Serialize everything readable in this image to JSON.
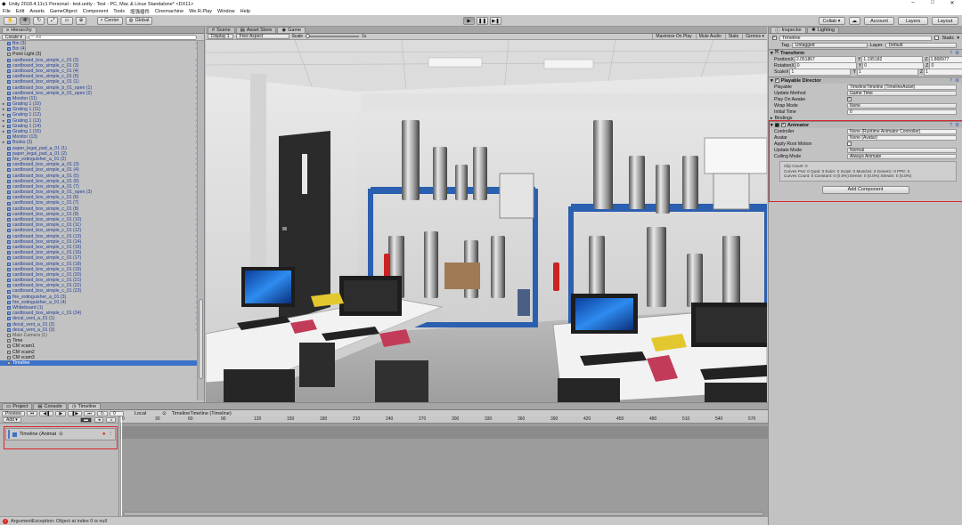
{
  "window": {
    "title": "Unity 2018.4.11c1 Personal - test.unity - Test - PC, Mac & Linux Standalone* <DX11>",
    "controls": [
      "–",
      "□",
      "✕"
    ]
  },
  "menu": [
    "File",
    "Edit",
    "Assets",
    "GameObject",
    "Component",
    "Tools",
    "增强插件",
    "Cinemachine",
    "We.R.Play",
    "Window",
    "Help"
  ],
  "toolbar": {
    "pivot_label": "Center",
    "space_label": "Global",
    "collab_label": "Collab ▾",
    "account_label": "Account",
    "layers_label": "Layers",
    "layout_label": "Layout"
  },
  "hierarchy": {
    "tab_label": "Hierarchy",
    "create_label": "Create ▾",
    "search_placeholder": "All",
    "items": [
      {
        "label": "Bin (3)",
        "type": "blue",
        "arrow": false
      },
      {
        "label": "Bin (4)",
        "type": "blue",
        "arrow": false
      },
      {
        "label": "Point Light (3)",
        "type": "black",
        "arrow": false
      },
      {
        "label": "cardboard_box_simple_c_01 (2)",
        "type": "blue",
        "arrow": false
      },
      {
        "label": "cardboard_box_simple_c_01 (3)",
        "type": "blue",
        "arrow": false
      },
      {
        "label": "cardboard_box_simple_c_01 (4)",
        "type": "blue",
        "arrow": false
      },
      {
        "label": "cardboard_box_simple_c_01 (5)",
        "type": "blue",
        "arrow": false
      },
      {
        "label": "cardboard_box_simple_a_01 (1)",
        "type": "blue",
        "arrow": false
      },
      {
        "label": "cardboard_box_simple_b_01_open (1)",
        "type": "blue",
        "arrow": false
      },
      {
        "label": "cardboard_box_simple_b_01_open (2)",
        "type": "blue",
        "arrow": false
      },
      {
        "label": "Monitor (11)",
        "type": "blue",
        "arrow": false
      },
      {
        "label": "Grating 1 (10)",
        "type": "blue",
        "arrow": true
      },
      {
        "label": "Grating 1 (11)",
        "type": "blue",
        "arrow": true
      },
      {
        "label": "Grating 1 (12)",
        "type": "blue",
        "arrow": true
      },
      {
        "label": "Grating 1 (13)",
        "type": "blue",
        "arrow": true
      },
      {
        "label": "Grating 1 (14)",
        "type": "blue",
        "arrow": true
      },
      {
        "label": "Grating 1 (15)",
        "type": "blue",
        "arrow": true
      },
      {
        "label": "Monitor (13)",
        "type": "blue",
        "arrow": false
      },
      {
        "label": "Books (3)",
        "type": "blue",
        "arrow": true
      },
      {
        "label": "paper_legal_pad_a_01 (1)",
        "type": "blue",
        "arrow": false
      },
      {
        "label": "paper_legal_pad_a_01 (2)",
        "type": "blue",
        "arrow": false
      },
      {
        "label": "fire_extinguisher_a_01 (2)",
        "type": "blue",
        "arrow": false
      },
      {
        "label": "cardboard_box_simple_a_01 (3)",
        "type": "blue",
        "arrow": false
      },
      {
        "label": "cardboard_box_simple_a_01 (4)",
        "type": "blue",
        "arrow": false
      },
      {
        "label": "cardboard_box_simple_a_01 (5)",
        "type": "blue",
        "arrow": false
      },
      {
        "label": "cardboard_box_simple_a_01 (6)",
        "type": "blue",
        "arrow": false
      },
      {
        "label": "cardboard_box_simple_a_01 (7)",
        "type": "blue",
        "arrow": false
      },
      {
        "label": "cardboard_box_simple_b_01_open (3)",
        "type": "blue",
        "arrow": false
      },
      {
        "label": "cardboard_box_simple_c_01 (6)",
        "type": "blue",
        "arrow": false
      },
      {
        "label": "cardboard_box_simple_c_01 (7)",
        "type": "blue",
        "arrow": false
      },
      {
        "label": "cardboard_box_simple_c_01 (8)",
        "type": "blue",
        "arrow": false
      },
      {
        "label": "cardboard_box_simple_c_01 (9)",
        "type": "blue",
        "arrow": false
      },
      {
        "label": "cardboard_box_simple_c_01 (10)",
        "type": "blue",
        "arrow": false
      },
      {
        "label": "cardboard_box_simple_c_01 (11)",
        "type": "blue",
        "arrow": false
      },
      {
        "label": "cardboard_box_simple_c_01 (12)",
        "type": "blue",
        "arrow": false
      },
      {
        "label": "cardboard_box_simple_c_01 (13)",
        "type": "blue",
        "arrow": false
      },
      {
        "label": "cardboard_box_simple_c_01 (14)",
        "type": "blue",
        "arrow": false
      },
      {
        "label": "cardboard_box_simple_c_01 (15)",
        "type": "blue",
        "arrow": false
      },
      {
        "label": "cardboard_box_simple_c_01 (16)",
        "type": "blue",
        "arrow": false
      },
      {
        "label": "cardboard_box_simple_c_01 (17)",
        "type": "blue",
        "arrow": false
      },
      {
        "label": "cardboard_box_simple_c_01 (18)",
        "type": "blue",
        "arrow": false
      },
      {
        "label": "cardboard_box_simple_c_01 (19)",
        "type": "blue",
        "arrow": false
      },
      {
        "label": "cardboard_box_simple_c_01 (20)",
        "type": "blue",
        "arrow": false
      },
      {
        "label": "cardboard_box_simple_c_01 (21)",
        "type": "blue",
        "arrow": false
      },
      {
        "label": "cardboard_box_simple_c_01 (22)",
        "type": "blue",
        "arrow": false
      },
      {
        "label": "cardboard_box_simple_c_01 (23)",
        "type": "blue",
        "arrow": false
      },
      {
        "label": "fire_extinguisher_a_01 (3)",
        "type": "blue",
        "arrow": false
      },
      {
        "label": "fire_extinguisher_a_01 (4)",
        "type": "blue",
        "arrow": false
      },
      {
        "label": "Whiteboard (1)",
        "type": "blue",
        "arrow": false
      },
      {
        "label": "cardboard_box_simple_c_01 (24)",
        "type": "blue",
        "arrow": false
      },
      {
        "label": "decal_vent_a_01 (1)",
        "type": "blue",
        "arrow": false
      },
      {
        "label": "decal_vent_a_01 (2)",
        "type": "blue",
        "arrow": false
      },
      {
        "label": "decal_vent_a_01 (3)",
        "type": "blue",
        "arrow": false
      },
      {
        "label": "Main Camera (1)",
        "type": "gray",
        "arrow": false
      },
      {
        "label": "Time",
        "type": "black",
        "arrow": false
      },
      {
        "label": "CM vcam1",
        "type": "black",
        "arrow": false
      },
      {
        "label": "CM vcam2",
        "type": "black",
        "arrow": false
      },
      {
        "label": "CM vcam3",
        "type": "black",
        "arrow": false
      },
      {
        "label": "Timeline",
        "type": "selected",
        "arrow": false
      }
    ]
  },
  "scene_tabs": [
    "Scene",
    "Asset Store",
    "Game"
  ],
  "game_bar": {
    "display": "Display 1",
    "aspect": "Free Aspect",
    "scale_label": "Scale",
    "scale_value": "1x",
    "right_buttons": [
      "Maximize On Play",
      "Mute Audio",
      "Stats",
      "Gizmos ▾"
    ]
  },
  "inspector": {
    "tabs": [
      "Inspector",
      "Lighting"
    ],
    "object_name": "Timeline",
    "static_label": "Static",
    "tag_label": "Tag",
    "tag_value": "Untagged",
    "layer_label": "Layer",
    "layer_value": "Default",
    "transform": {
      "title": "Transform",
      "position": {
        "label": "Position",
        "x": "2.051867",
        "y": "1.195182",
        "z": "1.868977"
      },
      "rotation": {
        "label": "Rotation",
        "x": "0",
        "y": "0",
        "z": "0"
      },
      "scale": {
        "label": "Scale",
        "x": "1",
        "y": "1",
        "z": "1"
      }
    },
    "playable_director": {
      "title": "Playable Director",
      "rows": [
        {
          "k": "Playable",
          "v": "TimelineTimeline (TimelineAsset)"
        },
        {
          "k": "Update Method",
          "v": "Game Time"
        },
        {
          "k": "Play On Awake",
          "v": "✓"
        },
        {
          "k": "Wrap Mode",
          "v": "None"
        },
        {
          "k": "Initial Time",
          "v": "0"
        }
      ],
      "bindings_label": "Bindings"
    },
    "animator": {
      "title": "Animator",
      "rows": [
        {
          "k": "Controller",
          "v": "None (Runtime Animator Controller)"
        },
        {
          "k": "Avatar",
          "v": "None (Avatar)"
        },
        {
          "k": "Apply Root Motion",
          "v": ""
        },
        {
          "k": "Update Mode",
          "v": "Normal"
        },
        {
          "k": "Culling Mode",
          "v": "Always Animate"
        }
      ],
      "info_lines": [
        "Clip Count: 0",
        "Curves Pos: 0 Quat: 0 Euler: 0 Scale: 0 Muscles: 0 Generic: 0 PPtr: 0",
        "Curves Count: 0 Constant: 0 (0.0%) Dense: 0 (0.0%) Stream: 0 (0.0%)"
      ]
    },
    "add_component_label": "Add Component"
  },
  "bottom_tabs": [
    "Project",
    "Console",
    "Timeline"
  ],
  "timeline": {
    "preview_label": "Preview",
    "frame_value": "0",
    "local_label": "Local",
    "add_label": "Add ▾",
    "asset_label": "TimelineTimeline (Timeline)",
    "track_label": "Timeline (Animat",
    "ticks": [
      "0",
      "30",
      "60",
      "90",
      "120",
      "150",
      "180",
      "210",
      "240",
      "270",
      "300",
      "330",
      "360",
      "390",
      "420",
      "450",
      "480",
      "510",
      "540",
      "570"
    ]
  },
  "status": {
    "message": "ArgumentException: Object at index 0 is null"
  },
  "colors": {
    "selection": "#3d72c9",
    "highlight": "#d9262c",
    "play_mode_tint": "#c2c2c2"
  }
}
